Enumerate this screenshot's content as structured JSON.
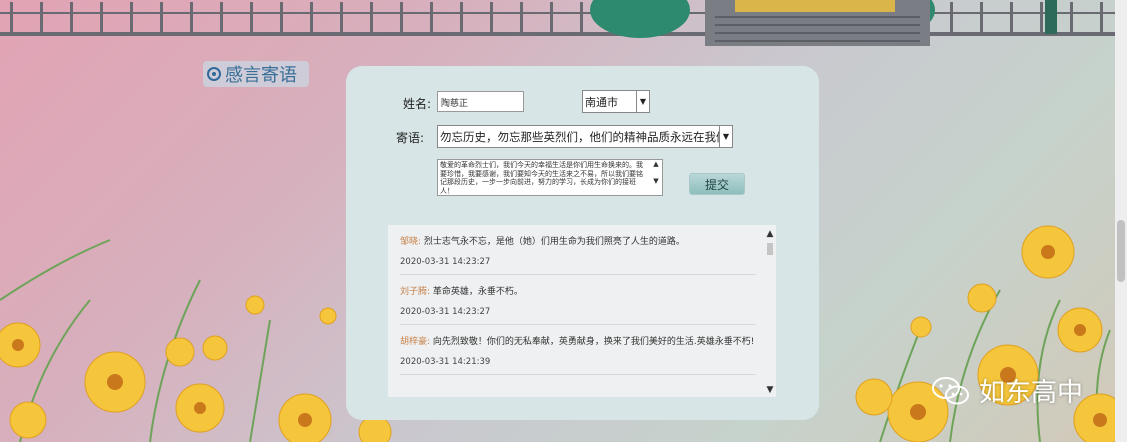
{
  "section": {
    "title": "感言寄语"
  },
  "form": {
    "name_label": "姓名:",
    "name_value": "陶慈正",
    "city_value": "南通市",
    "message_label": "寄语:",
    "message_selected": "勿忘历史，勿忘那些英烈们，他们的精神品质永远在我们的心中",
    "textarea_value": "敬爱的革命烈士们，我们今天的幸福生活是你们用生命换来的。我要珍惜，我要感谢，我们要知今天的生活来之不易，所以我们要铭记那段历史，一步一步向前进，努力的学习，长成为你们的接班人！",
    "submit_label": "提交"
  },
  "comments": [
    {
      "author": "邹晓:",
      "text": "烈士志气永不忘，是他（她）们用生命为我们照亮了人生的道路。",
      "time": "2020-03-31 14:23:27"
    },
    {
      "author": "刘子腾:",
      "text": "革命英雄，永垂不朽。",
      "time": "2020-03-31 14:23:27"
    },
    {
      "author": "胡梓豪:",
      "text": "向先烈致敬！你们的无私奉献，英勇献身，换来了我们美好的生活.英雄永垂不朽!",
      "time": "2020-03-31 14:21:39"
    }
  ],
  "watermark": {
    "label": "如东高中",
    "icon": "wechat-icon"
  },
  "colors": {
    "panel": "#d7e5e6",
    "title": "#3a6f98",
    "author": "#c8824a"
  }
}
